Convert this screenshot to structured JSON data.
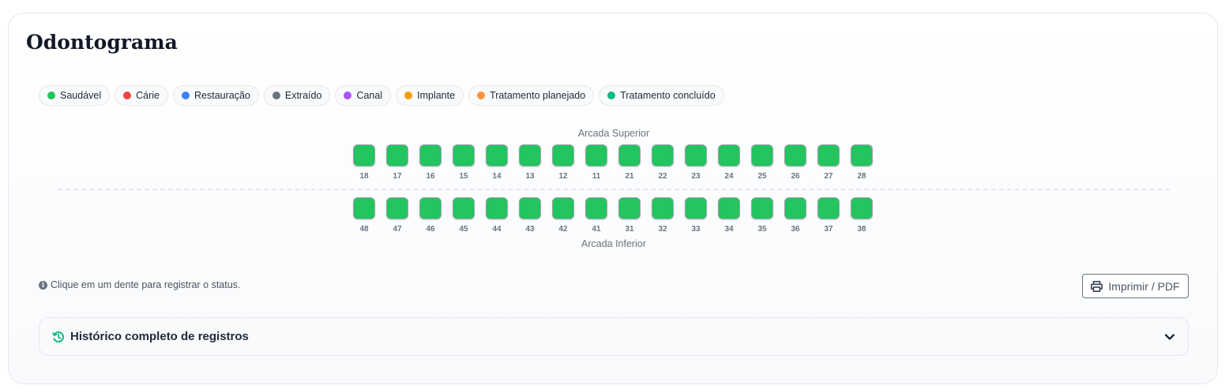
{
  "title": "Odontograma",
  "legend": [
    {
      "label": "Saudável",
      "color": "#22c55e"
    },
    {
      "label": "Cárie",
      "color": "#ef4444"
    },
    {
      "label": "Restauração",
      "color": "#3b82f6"
    },
    {
      "label": "Extraído",
      "color": "#6b7280"
    },
    {
      "label": "Canal",
      "color": "#a855f7"
    },
    {
      "label": "Implante",
      "color": "#f59e0b"
    },
    {
      "label": "Tratamento planejado",
      "color": "#fb923c"
    },
    {
      "label": "Tratamento concluído",
      "color": "#10b981"
    }
  ],
  "upper_arch": {
    "label": "Arcada Superior",
    "teeth": [
      "18",
      "17",
      "16",
      "15",
      "14",
      "13",
      "12",
      "11",
      "21",
      "22",
      "23",
      "24",
      "25",
      "26",
      "27",
      "28"
    ]
  },
  "lower_arch": {
    "label": "Arcada Inferior",
    "teeth": [
      "48",
      "47",
      "46",
      "45",
      "44",
      "43",
      "42",
      "41",
      "31",
      "32",
      "33",
      "34",
      "35",
      "36",
      "37",
      "38"
    ]
  },
  "tooth_status_color": "#22c55e",
  "hint": "Clique em um dente para registrar o status.",
  "print_button": "Imprimir / PDF",
  "history": {
    "title": "Histórico completo de registros",
    "accent": "#10b981"
  }
}
